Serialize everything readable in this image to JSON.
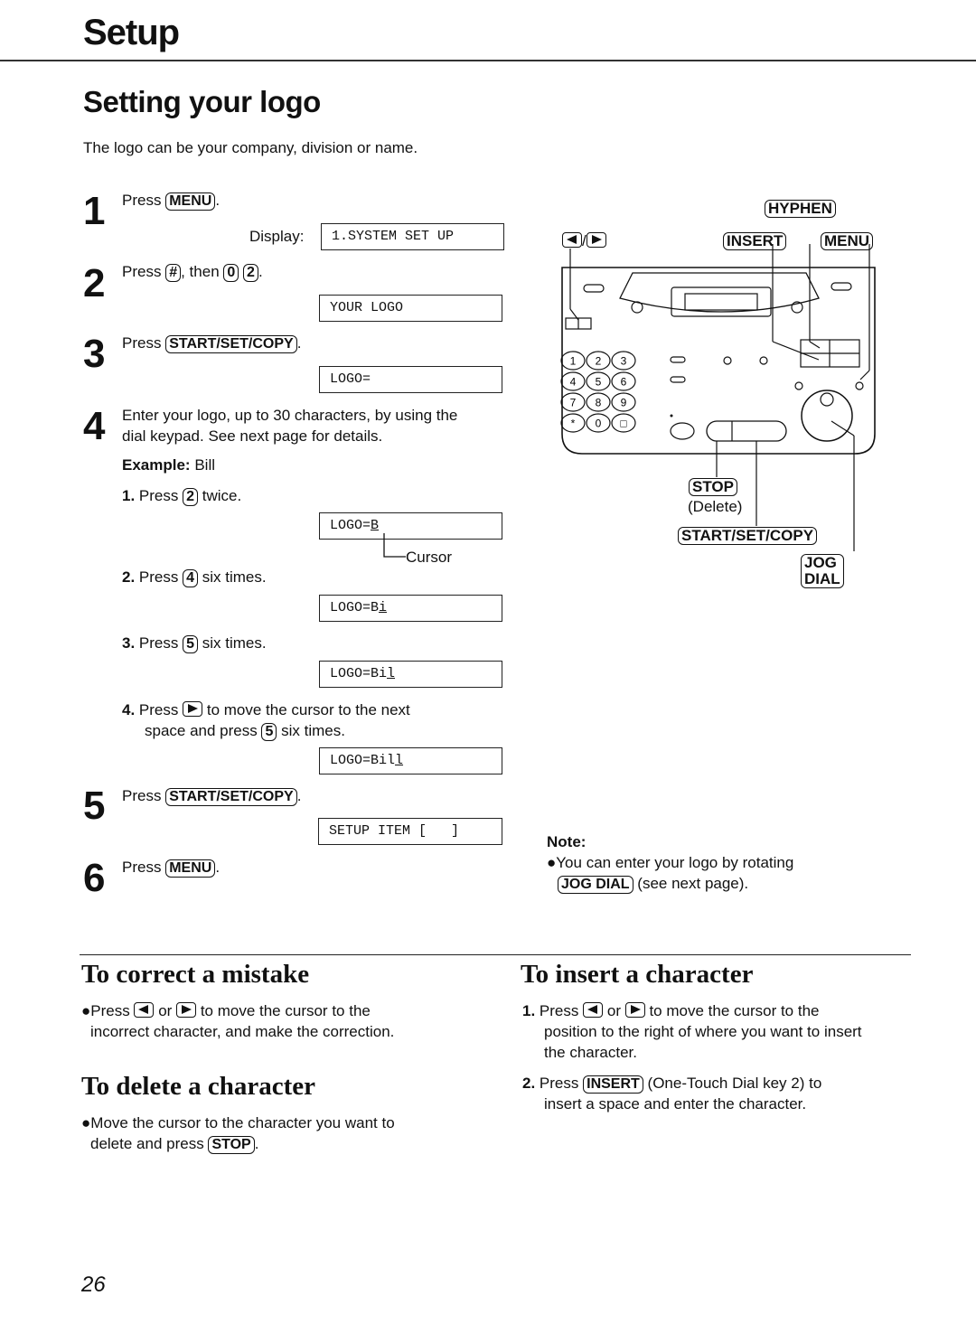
{
  "header": {
    "section": "Setup",
    "title": "Setting your logo"
  },
  "intro": "The logo can be your company, division or name.",
  "steps": [
    {
      "num": "1",
      "pre": "Press",
      "key": "MENU",
      "post": ".",
      "display_label": "Display:",
      "display": "1.SYSTEM SET UP"
    },
    {
      "num": "2",
      "pre": "Press",
      "key": "#",
      "mid": ", then",
      "key2": "0",
      "key3": "2",
      "post": ".",
      "display": "YOUR LOGO"
    },
    {
      "num": "3",
      "pre": "Press",
      "key": "START/SET/COPY",
      "post": ".",
      "display": "LOGO="
    },
    {
      "num": "4",
      "text_line1": "Enter your logo, up to 30 characters, by using the",
      "text_line2": "dial keypad. See next page for details."
    },
    {
      "num": "5",
      "pre": "Press",
      "key": "START/SET/COPY",
      "post": ".",
      "display": "SETUP ITEM [   ]"
    },
    {
      "num": "6",
      "pre": "Press",
      "key": "MENU",
      "post": "."
    }
  ],
  "example": {
    "label": "Example:",
    "value": "Bill",
    "substeps": [
      {
        "num": "1.",
        "pre": "Press",
        "key": "2",
        "post": "twice.",
        "display_prefix": "LOGO=",
        "display_cursor": "B",
        "cursor_label": "Cursor"
      },
      {
        "num": "2.",
        "pre": "Press",
        "key": "4",
        "post": "six times.",
        "display_prefix": "LOGO=B",
        "display_cursor": "i"
      },
      {
        "num": "3.",
        "pre": "Press",
        "key": "5",
        "post": "six times.",
        "display_prefix": "LOGO=Bi",
        "display_cursor": "l"
      },
      {
        "num": "4.",
        "pre": "Press",
        "key_icon": "right-arrow",
        "line1_post": "to move the cursor to the next",
        "line2_pre": "space and press",
        "key": "5",
        "line2_post": "six times.",
        "display_prefix": "LOGO=Bil",
        "display_cursor": "l"
      }
    ]
  },
  "fax_diagram": {
    "labels": {
      "arrows": "/",
      "hyphen": "HYPHEN",
      "insert": "INSERT",
      "menu": "MENU",
      "stop": "STOP",
      "stop_sub": "(Delete)",
      "start": "START/SET/COPY",
      "jog": "JOG DIAL"
    },
    "keypad": [
      "1",
      "2",
      "3",
      "4",
      "5",
      "6",
      "7",
      "8",
      "9",
      "*",
      "0",
      "□"
    ]
  },
  "note": {
    "title": "Note:",
    "line1": "You can enter your logo by rotating",
    "key": "JOG DIAL",
    "line2_post": "(see next page)."
  },
  "correct": {
    "title": "To correct a mistake",
    "pre": "Press",
    "or": "or",
    "line1_post": "to move the cursor to the",
    "line2": "incorrect character, and make the correction."
  },
  "delete": {
    "title": "To delete a character",
    "line1": "Move the cursor to the character you want to",
    "line2_pre": "delete and press",
    "key": "STOP",
    "post": "."
  },
  "insert": {
    "title": "To insert a character",
    "item1": {
      "num": "1.",
      "pre": "Press",
      "or": "or",
      "line1_post": "to move the cursor to the",
      "line2": "position to the right of where you want to insert",
      "line3": "the character."
    },
    "item2": {
      "num": "2.",
      "pre": "Press",
      "key": "INSERT",
      "line1_post": "(One-Touch Dial key 2) to",
      "line2": "insert a space and enter the character."
    }
  },
  "page_number": "26"
}
